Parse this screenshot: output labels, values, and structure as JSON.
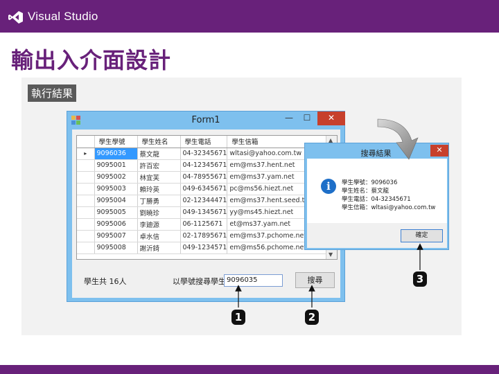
{
  "header": {
    "product": "Visual Studio",
    "brand_color": "#68217a",
    "logo_icon": "vs-logo-icon"
  },
  "slide": {
    "title": "輸出入介面設計",
    "run_label": "執行結果"
  },
  "form1": {
    "title": "Form1",
    "controls": {
      "minimize": "—",
      "maximize": "☐",
      "close": "✕"
    },
    "grid": {
      "columns": [
        "學生學號",
        "學生姓名",
        "學生電話",
        "學生信箱"
      ],
      "rows": [
        [
          "9096036",
          "蔡文龍",
          "04-32345671",
          "wltasi@yahoo.com.tw"
        ],
        [
          "9095001",
          "許百宏",
          "04-12345671",
          "em@ms37.hent.net"
        ],
        [
          "9095002",
          "林宜芙",
          "04-78955671",
          "em@ms37.yam.net"
        ],
        [
          "9095003",
          "賴玲英",
          "049-6345671",
          "pc@ms56.hiezt.net"
        ],
        [
          "9095004",
          "丁勝勇",
          "02-12344471",
          "em@ms37.hent.seed.tw"
        ],
        [
          "9095005",
          "劉曉珍",
          "049-1345671",
          "yy@ms45.hiezt.net"
        ],
        [
          "9095006",
          "李廸源",
          "06-1125671",
          "et@ms37.yam.net"
        ],
        [
          "9095007",
          "卓水信",
          "02-17895671",
          "em@ms37.pchome.net"
        ],
        [
          "9095008",
          "謝沂錡",
          "049-1234571",
          "em@ms56.pchome.net"
        ]
      ],
      "selected_row": 0,
      "row_marker": "▸"
    },
    "count_label": "學生共 16人",
    "search_label": "以學號搜尋學生",
    "search_value": "9096035",
    "search_button": "搜尋"
  },
  "dialog": {
    "title": "搜尋結果",
    "close": "✕",
    "info_icon": "info-icon",
    "lines": [
      "學生學號：9096036",
      "學生姓名：蔡文龍",
      "學生電話：04-32345671",
      "學生信箱：wltasi@yahoo.com.tw"
    ],
    "ok_button": "確定"
  },
  "callouts": [
    "1",
    "2",
    "3"
  ]
}
